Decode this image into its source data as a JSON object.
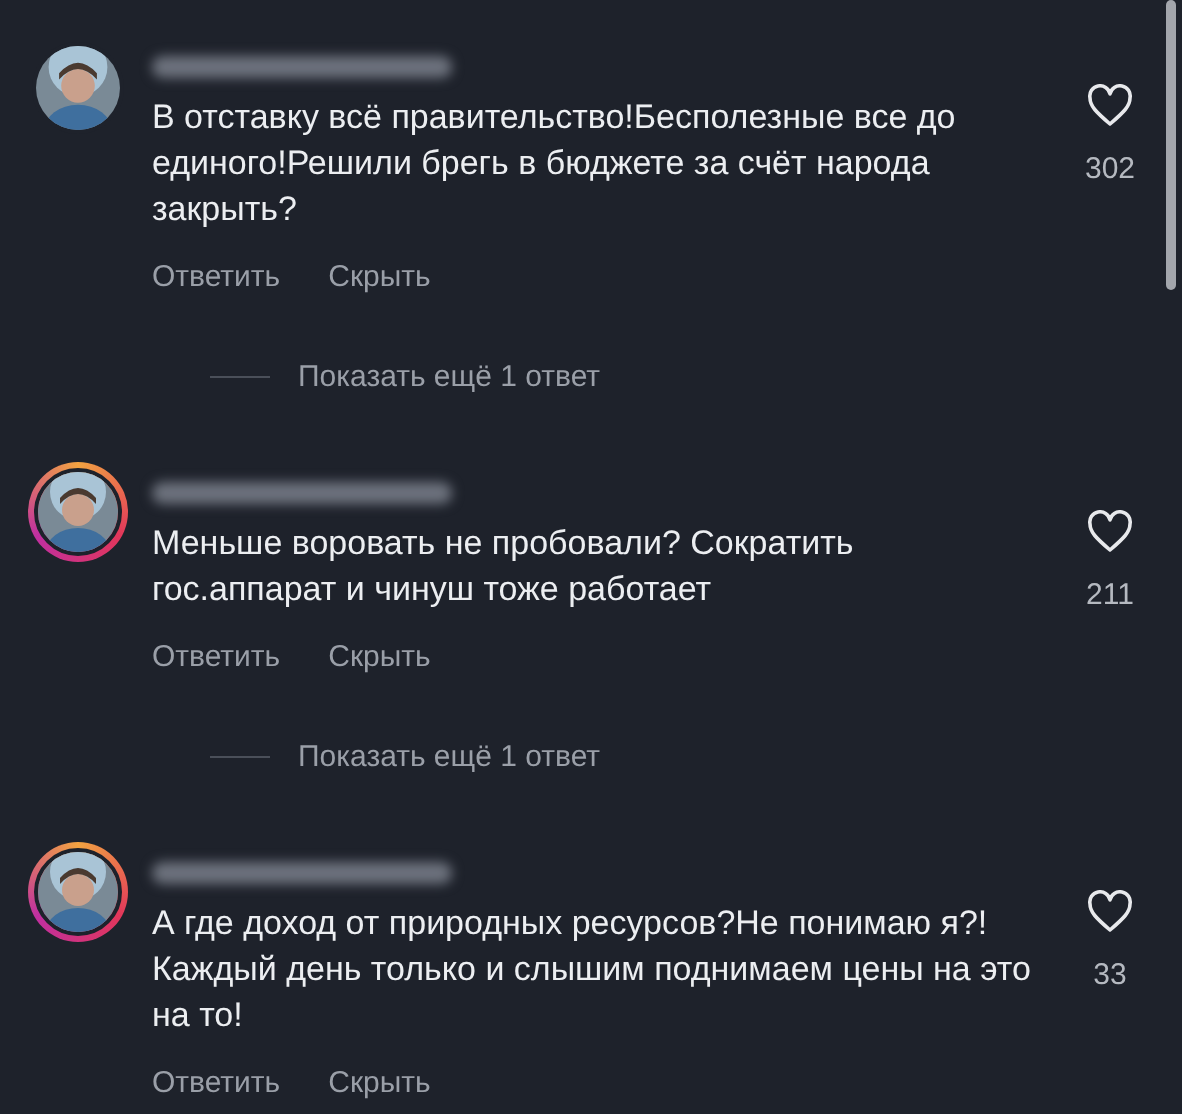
{
  "comments": [
    {
      "story_ring": false,
      "text": "В отставку всё правительство!Бесполезные все до единого!Решили брегь в бюджете за счёт народа закрыть?",
      "likes": "302",
      "actions": [
        "Ответить",
        "Скрыть"
      ],
      "more_replies": "Показать ещё 1 ответ"
    },
    {
      "story_ring": true,
      "text": "Меньше воровать не пробовали? Сократить гос.аппарат и чинуш тоже работает",
      "likes": "211",
      "actions": [
        "Ответить",
        "Скрыть"
      ],
      "more_replies": "Показать ещё 1 ответ"
    },
    {
      "story_ring": true,
      "text": "А где доход от природных ресурсов?Не понимаю я?! Каждый день только и слышим поднимаем цены на это на то!",
      "likes": "33",
      "actions": [
        "Ответить",
        "Скрыть"
      ]
    }
  ]
}
